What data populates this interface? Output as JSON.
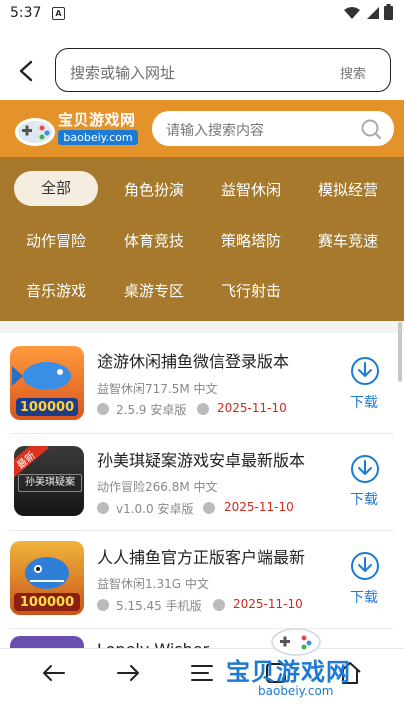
{
  "status": {
    "time": "5:37",
    "notification_letter": "A"
  },
  "browser": {
    "url_placeholder": "搜索或输入网址",
    "search_label": "搜索"
  },
  "site": {
    "logo_title": "宝贝游戏网",
    "logo_domain": "baobeiy.com",
    "search_placeholder": "请输入搜索内容",
    "accent_color": "#e3932a",
    "panel_color": "#a6792d"
  },
  "categories": [
    {
      "label": "全部",
      "active": true
    },
    {
      "label": "角色扮演"
    },
    {
      "label": "益智休闲"
    },
    {
      "label": "模拟经营"
    },
    {
      "label": "动作冒险"
    },
    {
      "label": "体育竞技"
    },
    {
      "label": "策略塔防"
    },
    {
      "label": "赛车竞速"
    },
    {
      "label": "音乐游戏"
    },
    {
      "label": "桌游专区"
    },
    {
      "label": "飞行射击"
    }
  ],
  "games": [
    {
      "title": "途游休闲捕鱼微信登录版本",
      "meta": "益智休闲717.5M 中文",
      "version": "2.5.9 安卓版",
      "date": "2025-11-10",
      "download": "下载",
      "thumb_text": "100000"
    },
    {
      "title": "孙美琪疑案游戏安卓最新版本",
      "meta": "动作冒险266.8M 中文",
      "version": "v1.0.0 安卓版",
      "date": "2025-11-10",
      "download": "下载",
      "thumb_text": "孙美琪疑案",
      "badge": "最新"
    },
    {
      "title": "人人捕鱼官方正版客户端最新",
      "meta": "益智休闲1.31G 中文",
      "version": "5.15.45 手机版",
      "date": "2025-11-10",
      "download": "下载",
      "thumb_text": "100000"
    },
    {
      "title": "Lonely Wisher",
      "meta": "",
      "version": "",
      "date": "",
      "download": ""
    }
  ],
  "watermark": {
    "title": "宝贝游戏网",
    "domain": "baobeiy.com"
  },
  "icons": {
    "back": "chevron-left-icon",
    "nav": [
      "arrow-left-icon",
      "arrow-right-icon",
      "menu-icon",
      "tabs-icon",
      "home-icon"
    ]
  }
}
